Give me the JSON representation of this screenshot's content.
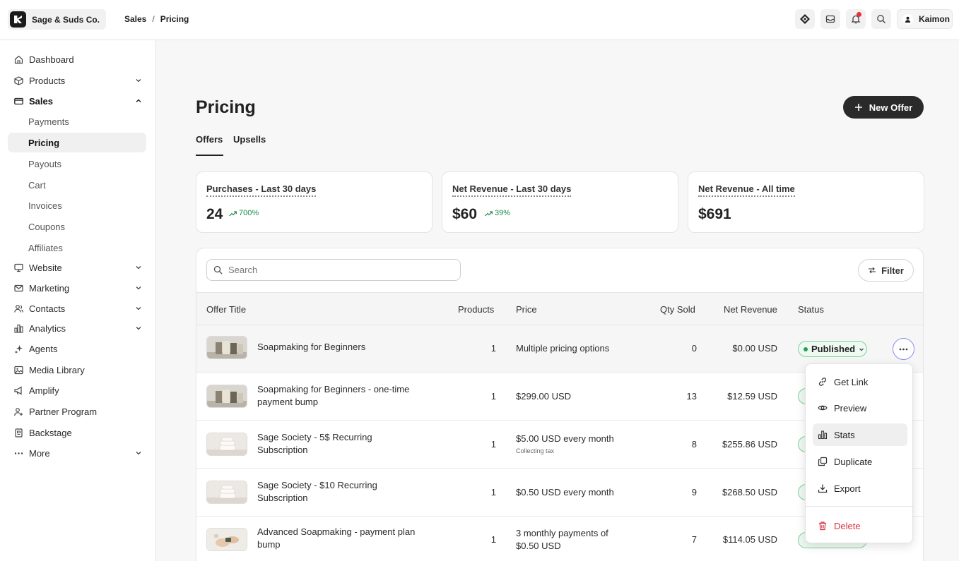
{
  "brand": {
    "name": "Sage & Suds Co."
  },
  "breadcrumb": [
    "Sales",
    "Pricing"
  ],
  "user": {
    "name": "Kaimon"
  },
  "sidebar": {
    "items": [
      {
        "label": "Dashboard",
        "icon": "home-icon"
      },
      {
        "label": "Products",
        "icon": "box-icon"
      },
      {
        "label": "Sales",
        "icon": "credit-card-icon"
      },
      {
        "label": "Website",
        "icon": "monitor-icon"
      },
      {
        "label": "Marketing",
        "icon": "mail-icon"
      },
      {
        "label": "Contacts",
        "icon": "users-icon"
      },
      {
        "label": "Analytics",
        "icon": "bar-chart-icon"
      },
      {
        "label": "Agents",
        "icon": "sparkle-icon"
      },
      {
        "label": "Media Library",
        "icon": "image-icon"
      },
      {
        "label": "Amplify",
        "icon": "megaphone-icon"
      },
      {
        "label": "Partner Program",
        "icon": "partner-icon"
      },
      {
        "label": "Backstage",
        "icon": "backstage-icon"
      },
      {
        "label": "More",
        "icon": "dots-icon"
      }
    ],
    "sales_sub": [
      "Payments",
      "Pricing",
      "Payouts",
      "Cart",
      "Invoices",
      "Coupons",
      "Affiliates"
    ]
  },
  "page": {
    "title": "Pricing",
    "new_offer_label": "New Offer"
  },
  "tabs": [
    "Offers",
    "Upsells"
  ],
  "stats": [
    {
      "label": "Purchases - Last 30 days",
      "value": "24",
      "trend": "700%"
    },
    {
      "label": "Net Revenue - Last 30 days",
      "value": "$60",
      "trend": "39%"
    },
    {
      "label": "Net Revenue - All time",
      "value": "$691",
      "trend": ""
    }
  ],
  "table": {
    "search_placeholder": "Search",
    "filter_label": "Filter",
    "columns": [
      "Offer Title",
      "Products",
      "Price",
      "Qty Sold",
      "Net Revenue",
      "Status"
    ],
    "rows": [
      {
        "title": "Soapmaking for Beginners",
        "products": "1",
        "price": "Multiple pricing options",
        "price_note": "",
        "qty": "0",
        "revenue": "$0.00 USD",
        "status": "Published"
      },
      {
        "title": "Soapmaking for Beginners - one-time payment bump",
        "products": "1",
        "price": "$299.00 USD",
        "price_note": "",
        "qty": "13",
        "revenue": "$12.59 USD",
        "status": ""
      },
      {
        "title": "Sage Society - 5$ Recurring Subscription",
        "products": "1",
        "price": "$5.00 USD every month",
        "price_note": "Collecting tax",
        "qty": "8",
        "revenue": "$255.86 USD",
        "status": ""
      },
      {
        "title": "Sage Society - $10 Recurring Subscription",
        "products": "1",
        "price": "$0.50 USD every month",
        "price_note": "",
        "qty": "9",
        "revenue": "$268.50 USD",
        "status": ""
      },
      {
        "title": "Advanced Soapmaking - payment plan bump",
        "products": "1",
        "price": "3 monthly payments of $0.50 USD",
        "price_note": "",
        "qty": "7",
        "revenue": "$114.05 USD",
        "status": ""
      }
    ]
  },
  "menu": {
    "items": [
      {
        "label": "Get Link",
        "icon": "link-icon"
      },
      {
        "label": "Preview",
        "icon": "eye-icon"
      },
      {
        "label": "Stats",
        "icon": "bar-chart-icon"
      },
      {
        "label": "Duplicate",
        "icon": "copy-icon"
      },
      {
        "label": "Export",
        "icon": "download-icon"
      },
      {
        "label": "Delete",
        "icon": "trash-icon"
      }
    ]
  },
  "colors": {
    "accent_dark": "#2a2a2a",
    "success": "#22a154",
    "danger": "#d9333f",
    "focus_ring": "#8c8cf0"
  }
}
